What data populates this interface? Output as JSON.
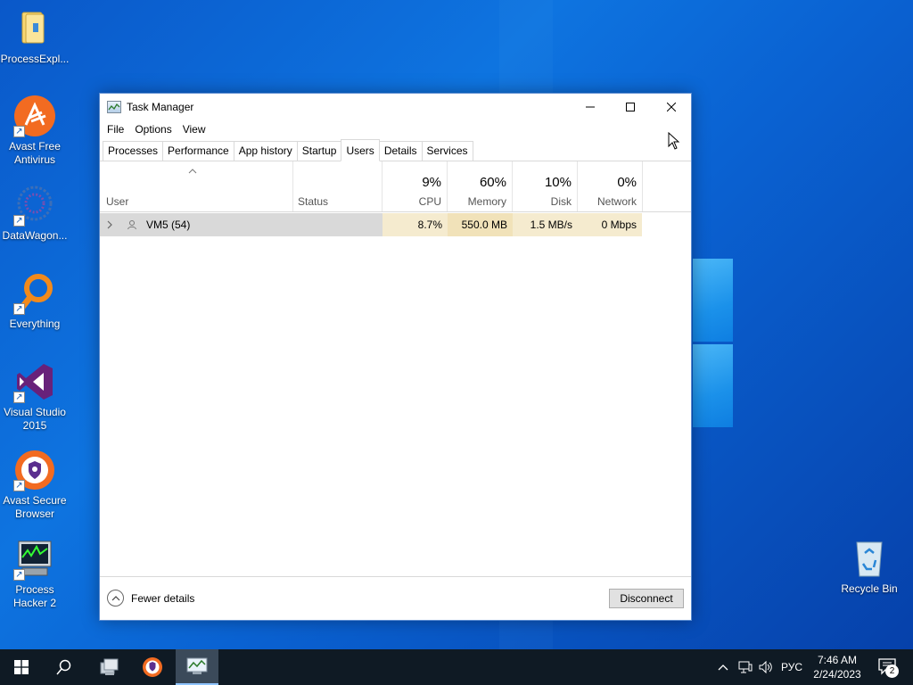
{
  "desktop": {
    "icons": [
      {
        "label": "ProcessExpl...",
        "icon": "folder-icon"
      },
      {
        "label": "Avast Free Antivirus",
        "icon": "avast-icon"
      },
      {
        "label": "DataWagon...",
        "icon": "datawagon-icon"
      },
      {
        "label": "Everything",
        "icon": "everything-search-icon"
      },
      {
        "label": "Visual Studio 2015",
        "icon": "visual-studio-icon"
      },
      {
        "label": "Avast Secure Browser",
        "icon": "avast-browser-icon"
      },
      {
        "label": "Process Hacker 2",
        "icon": "process-hacker-icon"
      },
      {
        "label": "Recycle Bin",
        "icon": "recycle-bin-icon"
      }
    ]
  },
  "window": {
    "title": "Task Manager",
    "menu": [
      "File",
      "Options",
      "View"
    ],
    "tabs": [
      "Processes",
      "Performance",
      "App history",
      "Startup",
      "Users",
      "Details",
      "Services"
    ],
    "active_tab": "Users",
    "columns": {
      "user": "User",
      "status": "Status",
      "cpu": {
        "pct": "9%",
        "label": "CPU"
      },
      "memory": {
        "pct": "60%",
        "label": "Memory"
      },
      "disk": {
        "pct": "10%",
        "label": "Disk"
      },
      "network": {
        "pct": "0%",
        "label": "Network"
      }
    },
    "rows": [
      {
        "user": "VM5 (54)",
        "status": "",
        "cpu": "8.7%",
        "memory": "550.0 MB",
        "disk": "1.5 MB/s",
        "network": "0 Mbps"
      }
    ],
    "footer": {
      "fewer_details": "Fewer details",
      "disconnect": "Disconnect"
    }
  },
  "taskbar": {
    "language": "РУС",
    "time": "7:46 AM",
    "date": "2/24/2023",
    "notification_count": "2"
  },
  "colors": {
    "desktop": "#0a62d2",
    "taskbar": "#0f1a24",
    "heat_light": "#f5ebcf",
    "heat_medium": "#f1e2b9",
    "selected_row": "#d9d9d9"
  }
}
